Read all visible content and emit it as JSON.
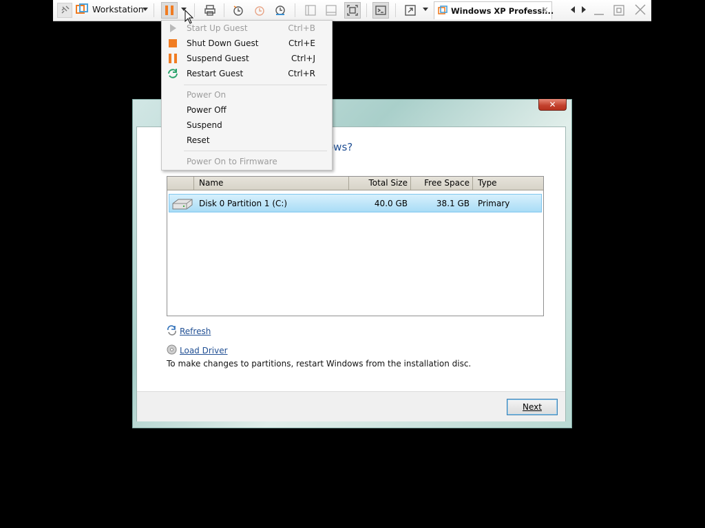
{
  "toolbar": {
    "workstation_label": "Workstation",
    "vm_tab_label": "Windows XP Professi...",
    "icons": [
      "pin-icon",
      "workstation-logo-icon",
      "dropdown-arrow-icon",
      "pause-icon",
      "print-icon",
      "snapshot-take-icon",
      "snapshot-revert-icon",
      "snapshot-manager-icon",
      "view-split-icon",
      "view-single-icon",
      "fit-window-icon",
      "console-icon",
      "fullscreen-icon",
      "tab-vm-icon",
      "close-icon",
      "prev-arrow-icon",
      "next-arrow-icon",
      "minimize-icon",
      "restore-icon",
      "window-close-icon"
    ],
    "accent_color": "#f07c22"
  },
  "power_menu": {
    "groups": [
      [
        {
          "label": "Start Up Guest",
          "shortcut": "Ctrl+B",
          "enabled": false,
          "icon": "play-icon"
        },
        {
          "label": "Shut Down Guest",
          "shortcut": "Ctrl+E",
          "enabled": true,
          "icon": "stop-icon"
        },
        {
          "label": "Suspend Guest",
          "shortcut": "Ctrl+J",
          "enabled": true,
          "icon": "pause-icon"
        },
        {
          "label": "Restart Guest",
          "shortcut": "Ctrl+R",
          "enabled": true,
          "icon": "restart-icon"
        }
      ],
      [
        {
          "label": "Power On",
          "shortcut": "",
          "enabled": false
        },
        {
          "label": "Power Off",
          "shortcut": "",
          "enabled": true
        },
        {
          "label": "Suspend",
          "shortcut": "",
          "enabled": true
        },
        {
          "label": "Reset",
          "shortcut": "",
          "enabled": true
        }
      ],
      [
        {
          "label": "Power On to Firmware",
          "shortcut": "",
          "enabled": false
        }
      ]
    ]
  },
  "setup": {
    "heading_visible": "ows?",
    "table": {
      "columns": [
        "Name",
        "Total Size",
        "Free Space",
        "Type"
      ],
      "rows": [
        {
          "name": "Disk 0 Partition 1 (C:)",
          "total_size": "40.0 GB",
          "free_space": "38.1 GB",
          "type": "Primary",
          "selected": true
        }
      ]
    },
    "refresh_link": "Refresh",
    "load_driver_link": "Load Driver",
    "hint": "To make changes to partitions, restart Windows from the installation disc.",
    "next_button": "Next",
    "close_glyph": "✕"
  }
}
